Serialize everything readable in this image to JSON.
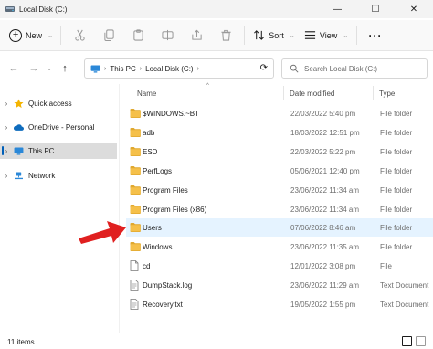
{
  "window": {
    "title": "Local Disk (C:)",
    "minimize": "—",
    "maximize": "☐",
    "close": "✕"
  },
  "toolbar": {
    "new_label": "New",
    "sort_label": "Sort",
    "view_label": "View",
    "more_label": "···"
  },
  "nav": {
    "back": "←",
    "forward": "→",
    "up": "↑",
    "breadcrumb": [
      "This PC",
      "Local Disk (C:)"
    ],
    "search_placeholder": "Search Local Disk (C:)"
  },
  "sidebar": {
    "items": [
      {
        "label": "Quick access",
        "icon": "star-icon",
        "color": "#f4b400"
      },
      {
        "label": "OneDrive - Personal",
        "icon": "cloud-icon",
        "color": "#0f6cbd"
      },
      {
        "label": "This PC",
        "icon": "monitor-icon",
        "color": "#2b88d8"
      },
      {
        "label": "Network",
        "icon": "network-icon",
        "color": "#2b88d8"
      }
    ]
  },
  "columns": {
    "name": "Name",
    "date": "Date modified",
    "type": "Type"
  },
  "files": [
    {
      "name": "$WINDOWS.~BT",
      "date": "22/03/2022 5:40 pm",
      "type": "File folder",
      "kind": "folder"
    },
    {
      "name": "adb",
      "date": "18/03/2022 12:51 pm",
      "type": "File folder",
      "kind": "folder"
    },
    {
      "name": "ESD",
      "date": "22/03/2022 5:22 pm",
      "type": "File folder",
      "kind": "folder"
    },
    {
      "name": "PerfLogs",
      "date": "05/06/2021 12:40 pm",
      "type": "File folder",
      "kind": "folder"
    },
    {
      "name": "Program Files",
      "date": "23/06/2022 11:34 am",
      "type": "File folder",
      "kind": "folder"
    },
    {
      "name": "Program Files (x86)",
      "date": "23/06/2022 11:34 am",
      "type": "File folder",
      "kind": "folder"
    },
    {
      "name": "Users",
      "date": "07/06/2022 8:46 am",
      "type": "File folder",
      "kind": "folder"
    },
    {
      "name": "Windows",
      "date": "23/06/2022 11:35 am",
      "type": "File folder",
      "kind": "folder"
    },
    {
      "name": "cd",
      "date": "12/01/2022 3:08 pm",
      "type": "File",
      "kind": "file"
    },
    {
      "name": "DumpStack.log",
      "date": "23/06/2022 11:29 am",
      "type": "Text Document",
      "kind": "doc"
    },
    {
      "name": "Recovery.txt",
      "date": "19/05/2022 1:55 pm",
      "type": "Text Document",
      "kind": "doc"
    }
  ],
  "status": {
    "item_count": "11 items"
  },
  "colors": {
    "folder": "#f5c04a",
    "folder_dark": "#e0a82e",
    "highlight": "#e5f3ff",
    "arrow": "#e02020",
    "accent": "#005fb8"
  }
}
